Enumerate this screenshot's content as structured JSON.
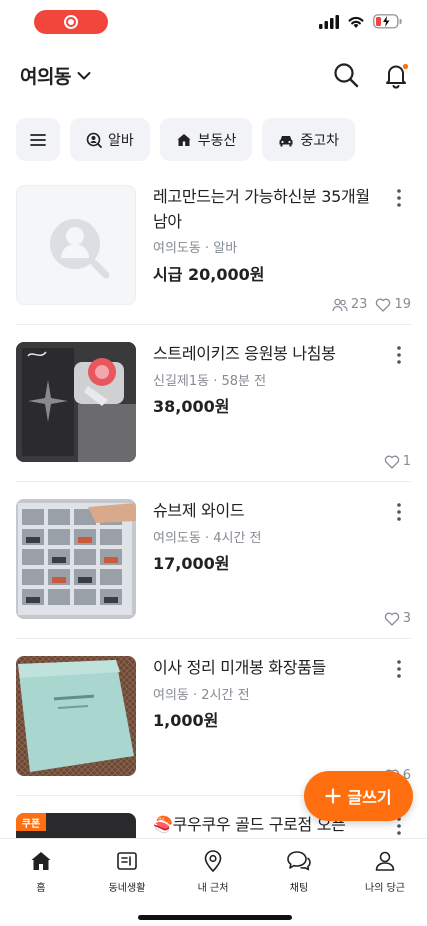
{
  "header": {
    "location": "여의동"
  },
  "chips": [
    {
      "label": "알바"
    },
    {
      "label": "부동산"
    },
    {
      "label": "중고차"
    }
  ],
  "items": [
    {
      "title": "레고만드는거 가능하신분 35개월 남아",
      "meta": "여의도동 · 알바",
      "price": "시급 20,000원",
      "applicants": "23",
      "likes": "19"
    },
    {
      "title": "스트레이키즈 응원봉 나침봉",
      "meta": "신길제1동 · 58분 전",
      "price": "38,000원",
      "likes": "1"
    },
    {
      "title": "슈브제 와이드",
      "meta": "여의도동 · 4시간 전",
      "price": "17,000원",
      "likes": "3"
    },
    {
      "title": "이사 정리 미개봉 화장품들",
      "meta": "여의동 · 2시간 전",
      "price": "1,000원",
      "likes": "6"
    },
    {
      "title": "🍣쿠우쿠우 골드 구로점 오픈",
      "badge": "쿠폰"
    }
  ],
  "fab": {
    "label": "글쓰기"
  },
  "nav": [
    {
      "label": "홈"
    },
    {
      "label": "동네생활"
    },
    {
      "label": "내 근처"
    },
    {
      "label": "채팅"
    },
    {
      "label": "나의 당근"
    }
  ],
  "colors": {
    "brand": "#ff6f0f",
    "recording": "#f2453b",
    "meta_text": "#868b94"
  }
}
